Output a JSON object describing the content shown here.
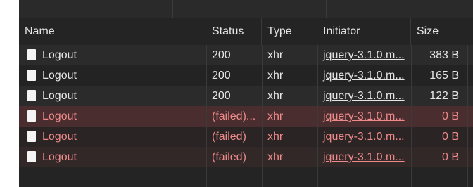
{
  "columns": {
    "name": "Name",
    "status": "Status",
    "type": "Type",
    "initiator": "Initiator",
    "size": "Size"
  },
  "rows": [
    {
      "name": "Logout",
      "status": "200",
      "type": "xhr",
      "initiator": "jquery-3.1.0.m...",
      "size": "383 B",
      "failed": false
    },
    {
      "name": "Logout",
      "status": "200",
      "type": "xhr",
      "initiator": "jquery-3.1.0.m...",
      "size": "165 B",
      "failed": false
    },
    {
      "name": "Logout",
      "status": "200",
      "type": "xhr",
      "initiator": "jquery-3.1.0.m...",
      "size": "122 B",
      "failed": false
    },
    {
      "name": "Logout",
      "status": "(failed)...",
      "type": "xhr",
      "initiator": "jquery-3.1.0.m...",
      "size": "0 B",
      "failed": true
    },
    {
      "name": "Logout",
      "status": "(failed)",
      "type": "xhr",
      "initiator": "jquery-3.1.0.m...",
      "size": "0 B",
      "failed": true
    },
    {
      "name": "Logout",
      "status": "(failed)",
      "type": "xhr",
      "initiator": "jquery-3.1.0.m...",
      "size": "0 B",
      "failed": true
    }
  ],
  "colors": {
    "background": "#242424",
    "failed_text": "#ef8a8a",
    "failed_row_highlight": "#4a2d2f",
    "text": "#e6e6e6"
  },
  "icons": {
    "row_icon": "document-icon"
  }
}
